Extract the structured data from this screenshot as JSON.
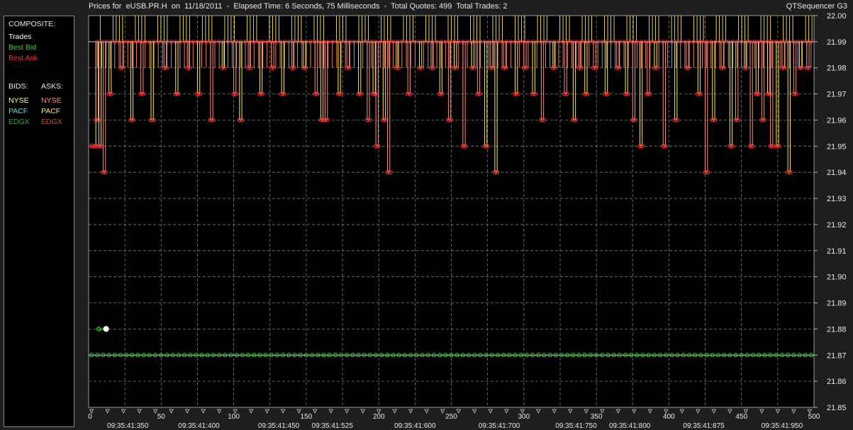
{
  "header": {
    "title": "Prices for  eUSB.PR.H  on  11/18/2011  -  Elapsed Time: 6 Seconds, 75 Milliseconds  -  Total Quotes: 499  Total Trades: 2",
    "app_name": "QTSequencer G3"
  },
  "legend": {
    "composite_label": "COMPOSITE:",
    "trades_label": "Trades",
    "best_bid_label": "Best Bid",
    "best_ask_label": "Best Ask",
    "bids_label": "BIDS:",
    "asks_label": "ASKS:",
    "bids": [
      "NYSE",
      "PACF",
      "EDGX"
    ],
    "asks": [
      "NYSE",
      "PACF",
      "EDGX"
    ]
  },
  "colors": {
    "plot_bg": "#000000",
    "grid": "#7a7a7a",
    "text": "#e8e8e8",
    "trades": "#ffffff",
    "best_bid": "#22dd22",
    "best_ask": "#ff3030",
    "nyse_bid": "#e8ff9c",
    "pacf_bid": "#4fe0e8",
    "edgx_bid": "#3f9a3f",
    "nyse_ask": "#ff8c7a",
    "pacf_ask": "#ffe84a",
    "edgx_ask": "#c0503c"
  },
  "chart_data": {
    "type": "line",
    "xlim": [
      0,
      500
    ],
    "ylim": [
      21.85,
      22.0
    ],
    "x_ticks": [
      0,
      50,
      100,
      150,
      200,
      250,
      300,
      350,
      400,
      450,
      500
    ],
    "y_ticks": [
      "21.85",
      "21.86",
      "21.87",
      "21.88",
      "21.89",
      "21.90",
      "21.91",
      "21.92",
      "21.93",
      "21.94",
      "21.95",
      "21.96",
      "21.97",
      "21.98",
      "21.99",
      "22.00"
    ],
    "time_labels": [
      {
        "x": 27,
        "label": "09:35:41:350"
      },
      {
        "x": 76,
        "label": "09:35:41:400"
      },
      {
        "x": 131,
        "label": "09:35:41:450"
      },
      {
        "x": 168,
        "label": "09:35:41:525"
      },
      {
        "x": 225,
        "label": "09:35:41:600"
      },
      {
        "x": 283,
        "label": "09:35:41:700"
      },
      {
        "x": 336,
        "label": "09:35:41:750"
      },
      {
        "x": 373,
        "label": "09:35:41:800"
      },
      {
        "x": 424,
        "label": "09:35:41:875"
      },
      {
        "x": 478,
        "label": "09:35:41:950"
      }
    ],
    "series": [
      {
        "name": "Best Bid",
        "constant": 21.87
      },
      {
        "name": "Best Ask",
        "base": 21.99,
        "dips": [
          [
            5,
            21.96
          ],
          [
            7,
            21.95
          ],
          [
            10,
            21.94
          ],
          [
            14,
            21.97
          ],
          [
            22,
            21.98
          ],
          [
            29,
            21.96
          ],
          [
            36,
            21.97
          ],
          [
            43,
            21.96
          ],
          [
            52,
            21.98
          ],
          [
            60,
            21.97
          ],
          [
            68,
            21.98
          ],
          [
            75,
            21.97
          ],
          [
            84,
            21.96
          ],
          [
            92,
            21.98
          ],
          [
            100,
            21.97
          ],
          [
            104,
            21.96
          ],
          [
            110,
            21.98
          ],
          [
            118,
            21.97
          ],
          [
            126,
            21.98
          ],
          [
            133,
            21.97
          ],
          [
            140,
            21.98
          ],
          [
            148,
            21.98
          ],
          [
            156,
            21.97
          ],
          [
            160,
            21.96
          ],
          [
            163,
            21.96
          ],
          [
            172,
            21.97
          ],
          [
            178,
            21.98
          ],
          [
            186,
            21.97
          ],
          [
            192,
            21.96
          ],
          [
            196,
            21.97
          ],
          [
            198,
            21.95
          ],
          [
            203,
            21.96
          ],
          [
            206,
            21.94
          ],
          [
            212,
            21.98
          ],
          [
            220,
            21.97
          ],
          [
            228,
            21.98
          ],
          [
            236,
            21.98
          ],
          [
            242,
            21.97
          ],
          [
            248,
            21.96
          ],
          [
            252,
            21.98
          ],
          [
            258,
            21.95
          ],
          [
            264,
            21.98
          ],
          [
            268,
            21.97
          ],
          [
            273,
            21.95
          ],
          [
            277,
            21.98
          ],
          [
            280,
            21.94
          ],
          [
            286,
            21.98
          ],
          [
            294,
            21.97
          ],
          [
            300,
            21.98
          ],
          [
            306,
            21.97
          ],
          [
            312,
            21.96
          ],
          [
            320,
            21.98
          ],
          [
            328,
            21.97
          ],
          [
            334,
            21.96
          ],
          [
            338,
            21.98
          ],
          [
            342,
            21.97
          ],
          [
            348,
            21.98
          ],
          [
            356,
            21.97
          ],
          [
            364,
            21.98
          ],
          [
            370,
            21.97
          ],
          [
            375,
            21.96
          ],
          [
            380,
            21.95
          ],
          [
            385,
            21.97
          ],
          [
            390,
            21.98
          ],
          [
            396,
            21.95
          ],
          [
            404,
            21.96
          ],
          [
            412,
            21.98
          ],
          [
            420,
            21.97
          ],
          [
            425,
            21.94
          ],
          [
            430,
            21.96
          ],
          [
            436,
            21.98
          ],
          [
            442,
            21.95
          ],
          [
            446,
            21.96
          ],
          [
            452,
            21.98
          ],
          [
            456,
            21.95
          ],
          [
            460,
            21.97
          ],
          [
            464,
            21.96
          ],
          [
            468,
            21.97
          ],
          [
            470,
            21.95
          ],
          [
            474,
            21.95
          ],
          [
            478,
            21.98
          ],
          [
            482,
            21.94
          ],
          [
            486,
            21.97
          ],
          [
            490,
            21.98
          ],
          [
            495,
            21.98
          ]
        ]
      },
      {
        "name": "Trades",
        "points": [
          [
            7,
            21.88
          ],
          [
            12,
            21.88
          ]
        ]
      }
    ]
  }
}
